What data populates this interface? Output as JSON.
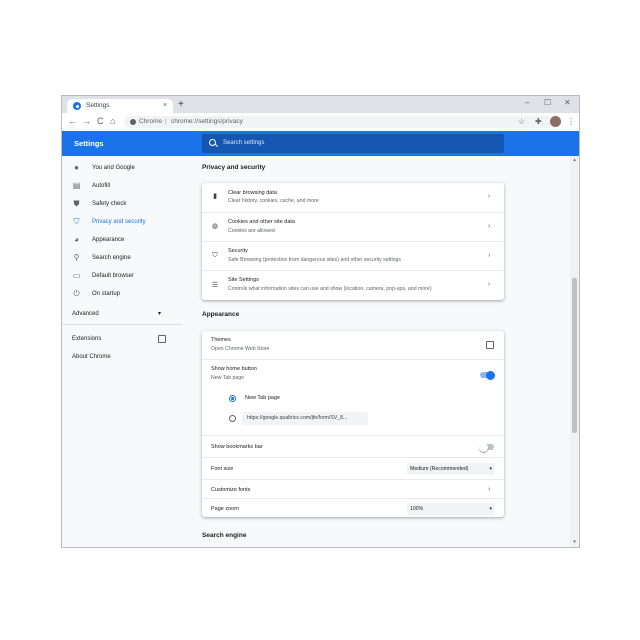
{
  "tab": {
    "title": "Settings",
    "close": "×",
    "new_tab": "+"
  },
  "window_controls": {
    "minimize": "–",
    "maximize": "☐",
    "close": "✕"
  },
  "toolbar": {
    "back": "←",
    "forward": "→",
    "reload": "C",
    "home": "⌂",
    "omnibox_label": "Chrome",
    "separator": "|",
    "url": "chrome://settings/privacy",
    "bookmark_star": "☆",
    "extensions": "✚",
    "menu": "⋮"
  },
  "header": {
    "title": "Settings",
    "search_placeholder": "Search settings"
  },
  "sidebar": {
    "items": [
      {
        "label": "You and Google",
        "icon": "person-icon",
        "glyph": "●",
        "active": false
      },
      {
        "label": "Autofill",
        "icon": "clipboard-icon",
        "glyph": "▤",
        "active": false
      },
      {
        "label": "Safety check",
        "icon": "shield-check-icon",
        "glyph": "⛊",
        "active": false
      },
      {
        "label": "Privacy and security",
        "icon": "shield-icon",
        "glyph": "⛉",
        "active": true
      },
      {
        "label": "Appearance",
        "icon": "palette-icon",
        "glyph": "◕",
        "active": false
      },
      {
        "label": "Search engine",
        "icon": "search-icon",
        "glyph": "⚲",
        "active": false
      },
      {
        "label": "Default browser",
        "icon": "browser-icon",
        "glyph": "▭",
        "active": false
      },
      {
        "label": "On startup",
        "icon": "power-icon",
        "glyph": "⏻",
        "active": false
      }
    ],
    "advanced": "Advanced",
    "advanced_arrow": "▾",
    "extensions": "Extensions",
    "about": "About Chrome"
  },
  "privacy": {
    "title": "Privacy and security",
    "rows": [
      {
        "title": "Clear browsing data",
        "subtitle": "Clear history, cookies, cache, and more",
        "icon": "trash-icon",
        "glyph": "▮"
      },
      {
        "title": "Cookies and other site data",
        "subtitle": "Cookies are allowed",
        "icon": "cookie-icon",
        "glyph": "◍"
      },
      {
        "title": "Security",
        "subtitle": "Safe Browsing (protection from dangerous sites) and other security settings",
        "icon": "security-shield-icon",
        "glyph": "⛉"
      },
      {
        "title": "Site Settings",
        "subtitle": "Controls what information sites can use and show (location, camera, pop-ups, and more)",
        "icon": "sliders-icon",
        "glyph": "☰"
      }
    ],
    "chevron": "›"
  },
  "appearance": {
    "title": "Appearance",
    "themes_title": "Themes",
    "themes_sub": "Open Chrome Web Store",
    "home_title": "Show home button",
    "home_sub": "New Tab page",
    "home_enabled": true,
    "radio_new_tab": "New Tab page",
    "radio_url_value": "https://google.qualtrics.com/jfe/form/SV_8...",
    "bookmarks_bar": "Show bookmarks bar",
    "bookmarks_enabled": false,
    "font_size_label": "Font size",
    "font_size_value": "Medium (Recommended)",
    "customize_fonts": "Customize fonts",
    "page_zoom_label": "Page zoom",
    "page_zoom_value": "100%",
    "select_arrow": "▾",
    "chevron": "›"
  },
  "search_engine": {
    "title": "Search engine"
  },
  "scroll": {
    "up": "▴",
    "down": "▾"
  },
  "colors": {
    "accent": "#1a73e8",
    "header": "#1a73e8",
    "search_bg": "#1557b0",
    "toggle_off": "#bdc1c6"
  }
}
